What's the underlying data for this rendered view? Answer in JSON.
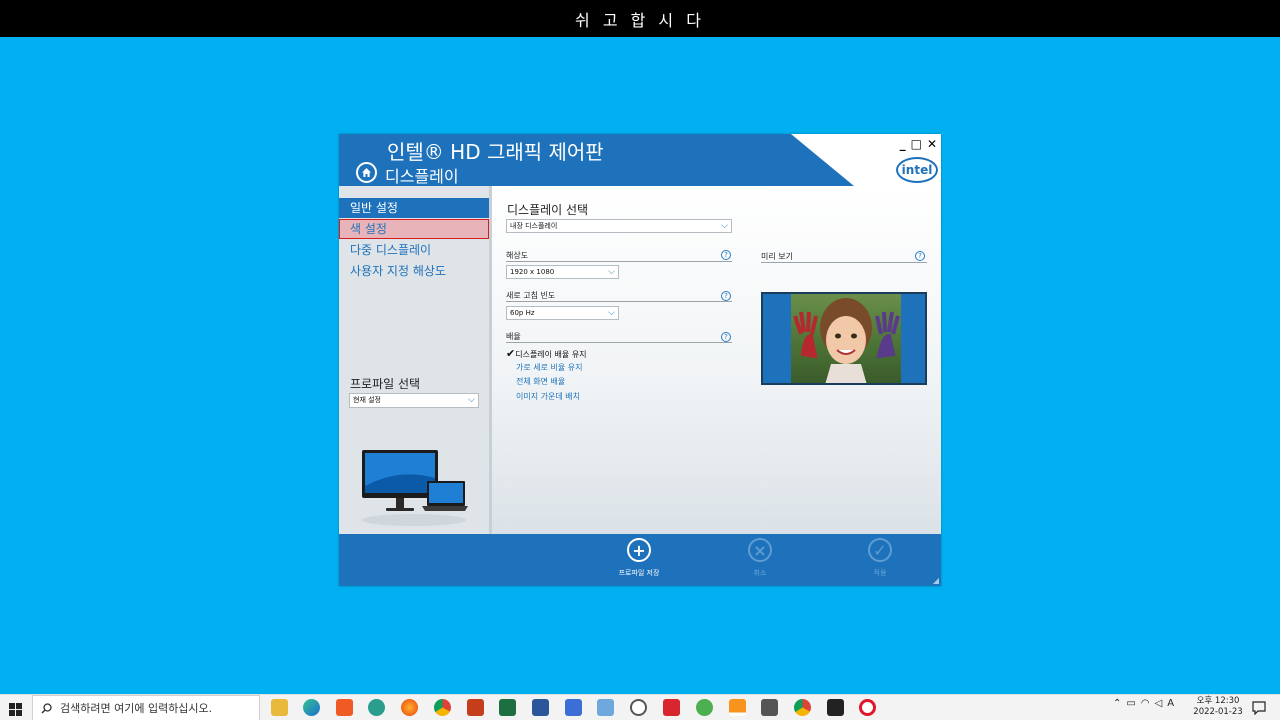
{
  "slide_title": "쉬 고 합 시 다",
  "window": {
    "app_title": "인텔® HD 그래픽 제어판",
    "section_title": "디스플레이",
    "controls": [
      "_",
      "□",
      "✕"
    ],
    "logo_text": "intel"
  },
  "sidebar": {
    "items": [
      {
        "label": "일반 설정",
        "state": "active"
      },
      {
        "label": "색 설정",
        "state": "hover"
      },
      {
        "label": "다중 디스플레이",
        "state": "normal"
      },
      {
        "label": "사용자 지정 해상도",
        "state": "normal"
      }
    ],
    "profile_label": "프로파일 선택",
    "profile_value": "현재 설정"
  },
  "main": {
    "display_select_label": "디스플레이 선택",
    "display_select_value": "내장 디스플레이",
    "resolution_label": "해상도",
    "resolution_value": "1920 x 1080",
    "refresh_label": "새로 고침 빈도",
    "refresh_value": "60p Hz",
    "scaling_label": "배율",
    "scaling_options": [
      {
        "label": "디스플레이 배율 유지",
        "checked": true
      },
      {
        "label": "가로 세로 비율 유지",
        "checked": false
      },
      {
        "label": "전체 화면 배율",
        "checked": false
      },
      {
        "label": "이미지 가운데 배치",
        "checked": false
      }
    ],
    "preview_label": "미리 보기",
    "help_glyph": "?"
  },
  "footer": {
    "save_label": "프로파일 저장",
    "cancel_label": "취소",
    "apply_label": "적용"
  },
  "taskbar": {
    "search_placeholder": "검색하려면 여기에 입력하십시오.",
    "tray_ime": "A",
    "clock_time": "오후 12:30",
    "clock_date": "2022-01-23"
  },
  "colors": {
    "background": "#00b0f0",
    "intel_blue": "#1e72bb",
    "hover_red": "#d21e1e"
  }
}
